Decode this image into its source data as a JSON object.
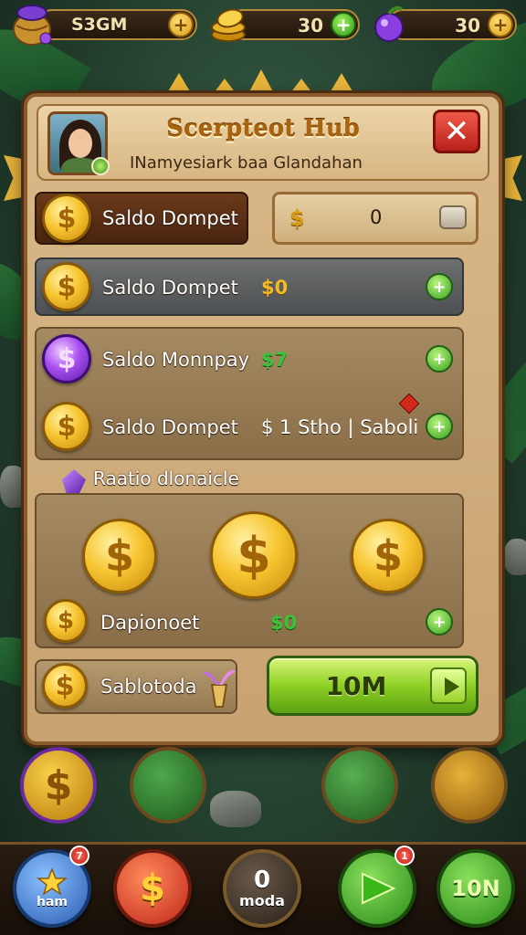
{
  "resources": [
    {
      "label": "S3GM",
      "icon": "jar-gems-icon"
    },
    {
      "label": "30",
      "icon": "gold-pile-icon"
    },
    {
      "label": "30",
      "icon": "purple-fruit-icon"
    }
  ],
  "panel": {
    "title": "Scerpteot Hub",
    "subtitle": "INamyesiark baa Glandahan",
    "close_label": "✕"
  },
  "rows": {
    "row1_label": "Saldo Dompet",
    "row1_value_symbol": "$",
    "row1_value": "0",
    "row2_label": "Saldo Dompet",
    "row2_value": "$0",
    "row3_label": "Saldo Monnpay",
    "row3_value": "$7",
    "row4_label": "Saldo Dompet",
    "row4_value": "$ 1 Stho | Saboli"
  },
  "section": {
    "title": "Raatio dlonaicle",
    "coin_row_label": "Dapionoet",
    "coin_row_value": "$0"
  },
  "bottom_row": {
    "label": "Sablotoda",
    "button_label": "10M"
  },
  "nav": [
    {
      "label": "ham",
      "icon": "star-home-icon",
      "badge": "7"
    },
    {
      "label": "",
      "icon": "dollar-icon",
      "badge": ""
    },
    {
      "label": "0",
      "sublabel": "moda",
      "icon": "center-mode-icon"
    },
    {
      "label": "",
      "icon": "play-arrow-icon",
      "badge": "1"
    },
    {
      "label": "10N",
      "icon": "green-10n-icon"
    }
  ],
  "colors": {
    "panel": "#d9b98a",
    "accent_green": "#8ed024",
    "close_red": "#d43a2c",
    "gold": "#f7c531"
  }
}
